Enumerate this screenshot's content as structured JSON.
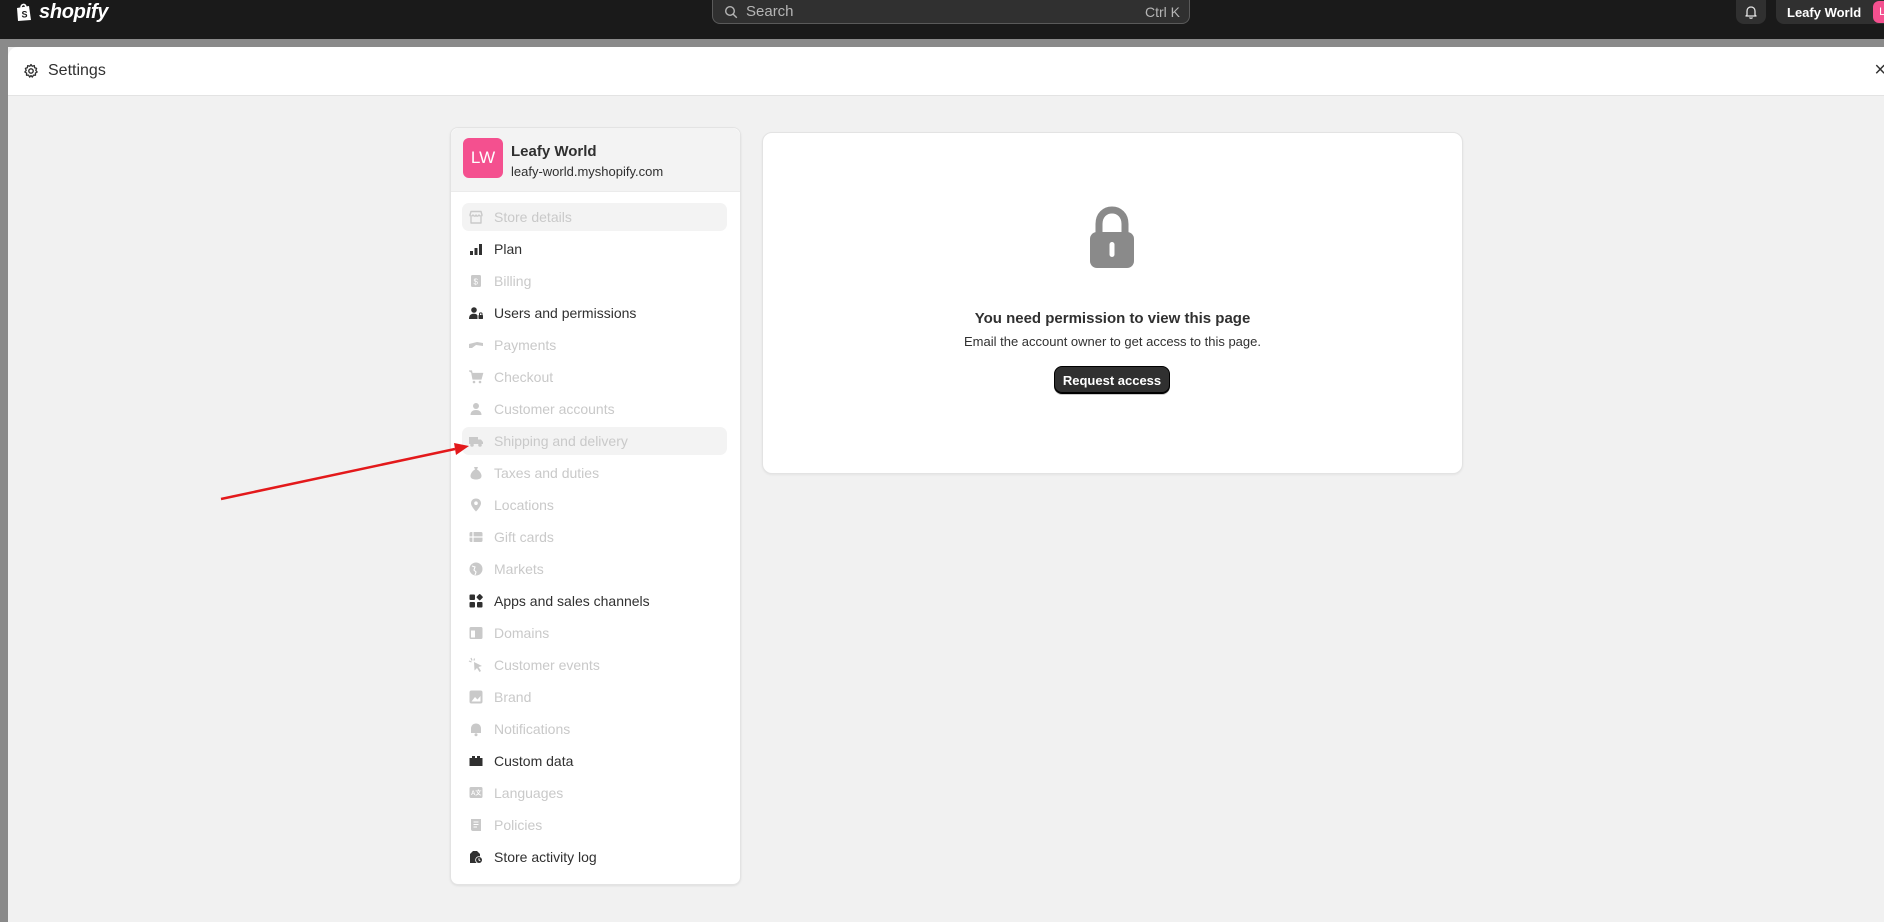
{
  "topbar": {
    "logo_text": "shopify",
    "search_placeholder": "Search",
    "search_shortcut": "Ctrl K",
    "account_name": "Leafy World",
    "account_initials": "LW"
  },
  "modal": {
    "title": "Settings"
  },
  "store": {
    "initials": "LW",
    "name": "Leafy World",
    "domain": "leafy-world.myshopify.com",
    "avatar_color": "#f4508f"
  },
  "nav": {
    "items": [
      {
        "label": "Store details",
        "icon": "store-icon",
        "enabled": false
      },
      {
        "label": "Plan",
        "icon": "plan-icon",
        "enabled": true
      },
      {
        "label": "Billing",
        "icon": "billing-icon",
        "enabled": false
      },
      {
        "label": "Users and permissions",
        "icon": "users-icon",
        "enabled": true
      },
      {
        "label": "Payments",
        "icon": "payments-icon",
        "enabled": false
      },
      {
        "label": "Checkout",
        "icon": "cart-icon",
        "enabled": false
      },
      {
        "label": "Customer accounts",
        "icon": "person-icon",
        "enabled": false
      },
      {
        "label": "Shipping and delivery",
        "icon": "truck-icon",
        "enabled": false
      },
      {
        "label": "Taxes and duties",
        "icon": "taxes-icon",
        "enabled": false
      },
      {
        "label": "Locations",
        "icon": "location-icon",
        "enabled": false
      },
      {
        "label": "Gift cards",
        "icon": "gift-card-icon",
        "enabled": false
      },
      {
        "label": "Markets",
        "icon": "globe-icon",
        "enabled": false
      },
      {
        "label": "Apps and sales channels",
        "icon": "apps-icon",
        "enabled": true
      },
      {
        "label": "Domains",
        "icon": "domains-icon",
        "enabled": false
      },
      {
        "label": "Customer events",
        "icon": "cursor-icon",
        "enabled": false
      },
      {
        "label": "Brand",
        "icon": "brand-icon",
        "enabled": false
      },
      {
        "label": "Notifications",
        "icon": "bell-icon",
        "enabled": false
      },
      {
        "label": "Custom data",
        "icon": "custom-data-icon",
        "enabled": true
      },
      {
        "label": "Languages",
        "icon": "languages-icon",
        "enabled": false
      },
      {
        "label": "Policies",
        "icon": "policies-icon",
        "enabled": false
      },
      {
        "label": "Store activity log",
        "icon": "activity-log-icon",
        "enabled": true
      }
    ]
  },
  "permission": {
    "title": "You need permission to view this page",
    "subtitle": "Email the account owner to get access to this page.",
    "button_label": "Request access"
  },
  "colors": {
    "topbar_bg": "#1a1a1a",
    "accent_pink": "#f4508f",
    "annotation_arrow": "#e3191b",
    "disabled_text": "#c9c9c9"
  }
}
